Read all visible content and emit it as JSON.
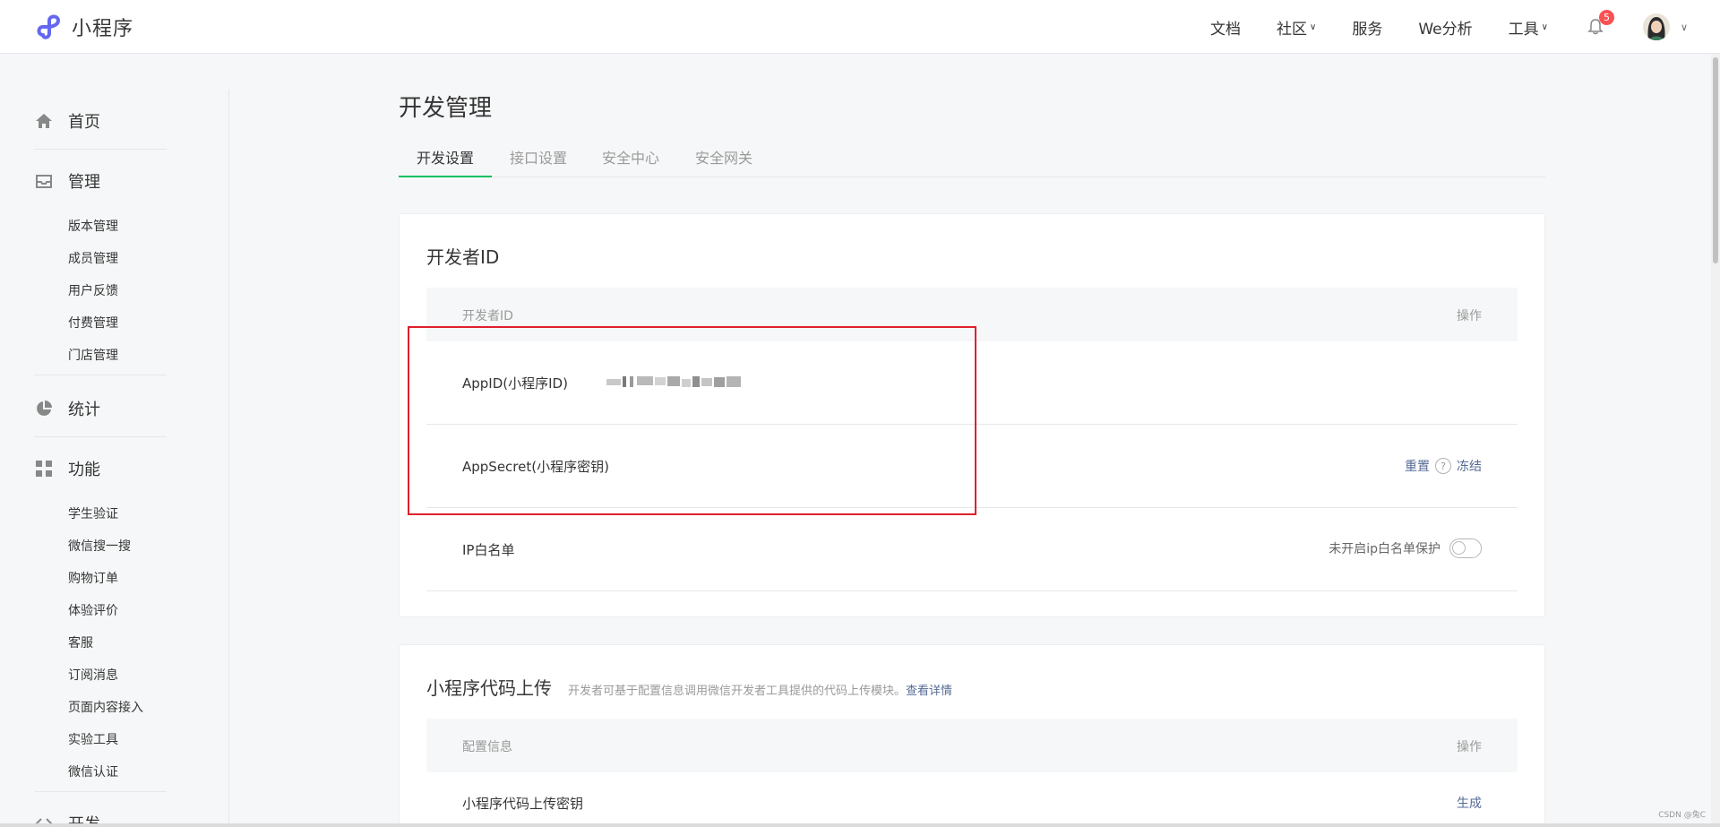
{
  "topbar": {
    "logo_text": "小程序",
    "nav": [
      {
        "label": "文档",
        "chevron": false
      },
      {
        "label": "社区",
        "chevron": true
      },
      {
        "label": "服务",
        "chevron": false
      },
      {
        "label": "We分析",
        "chevron": false
      },
      {
        "label": "工具",
        "chevron": true
      }
    ],
    "notification_count": "5",
    "accent_color": "#07c160",
    "badge_color": "#fa5151"
  },
  "sidebar": {
    "sections": [
      {
        "label": "首页",
        "icon": "home-icon"
      },
      {
        "label": "管理",
        "icon": "inbox-icon",
        "items": [
          "版本管理",
          "成员管理",
          "用户反馈",
          "付费管理",
          "门店管理"
        ]
      },
      {
        "label": "统计",
        "icon": "pie-chart-icon"
      },
      {
        "label": "功能",
        "icon": "grid-icon",
        "items": [
          "学生验证",
          "微信搜一搜",
          "购物订单",
          "体验评价",
          "客服",
          "订阅消息",
          "页面内容接入",
          "实验工具",
          "微信认证"
        ]
      },
      {
        "label": "开发",
        "icon": "code-icon"
      }
    ]
  },
  "main": {
    "page_title": "开发管理",
    "tabs": [
      "开发设置",
      "接口设置",
      "安全中心",
      "安全网关"
    ],
    "developer_card": {
      "title": "开发者ID",
      "header_left": "开发者ID",
      "header_right": "操作",
      "rows": {
        "appid_label": "AppID(小程序ID)",
        "appsecret_label": "AppSecret(小程序密钥)",
        "reset_action": "重置",
        "help_symbol": "?",
        "freeze_action": "冻结",
        "ip_label": "IP白名单",
        "ip_toggle_label": "未开启ip白名单保护"
      }
    },
    "upload_card": {
      "title": "小程序代码上传",
      "description": "开发者可基于配置信息调用微信开发者工具提供的代码上传模块。",
      "details_link": "查看详情",
      "header_left": "配置信息",
      "header_right": "操作",
      "row_label": "小程序代码上传密钥",
      "row_action": "生成"
    }
  },
  "watermark": "CSDN @兔C"
}
